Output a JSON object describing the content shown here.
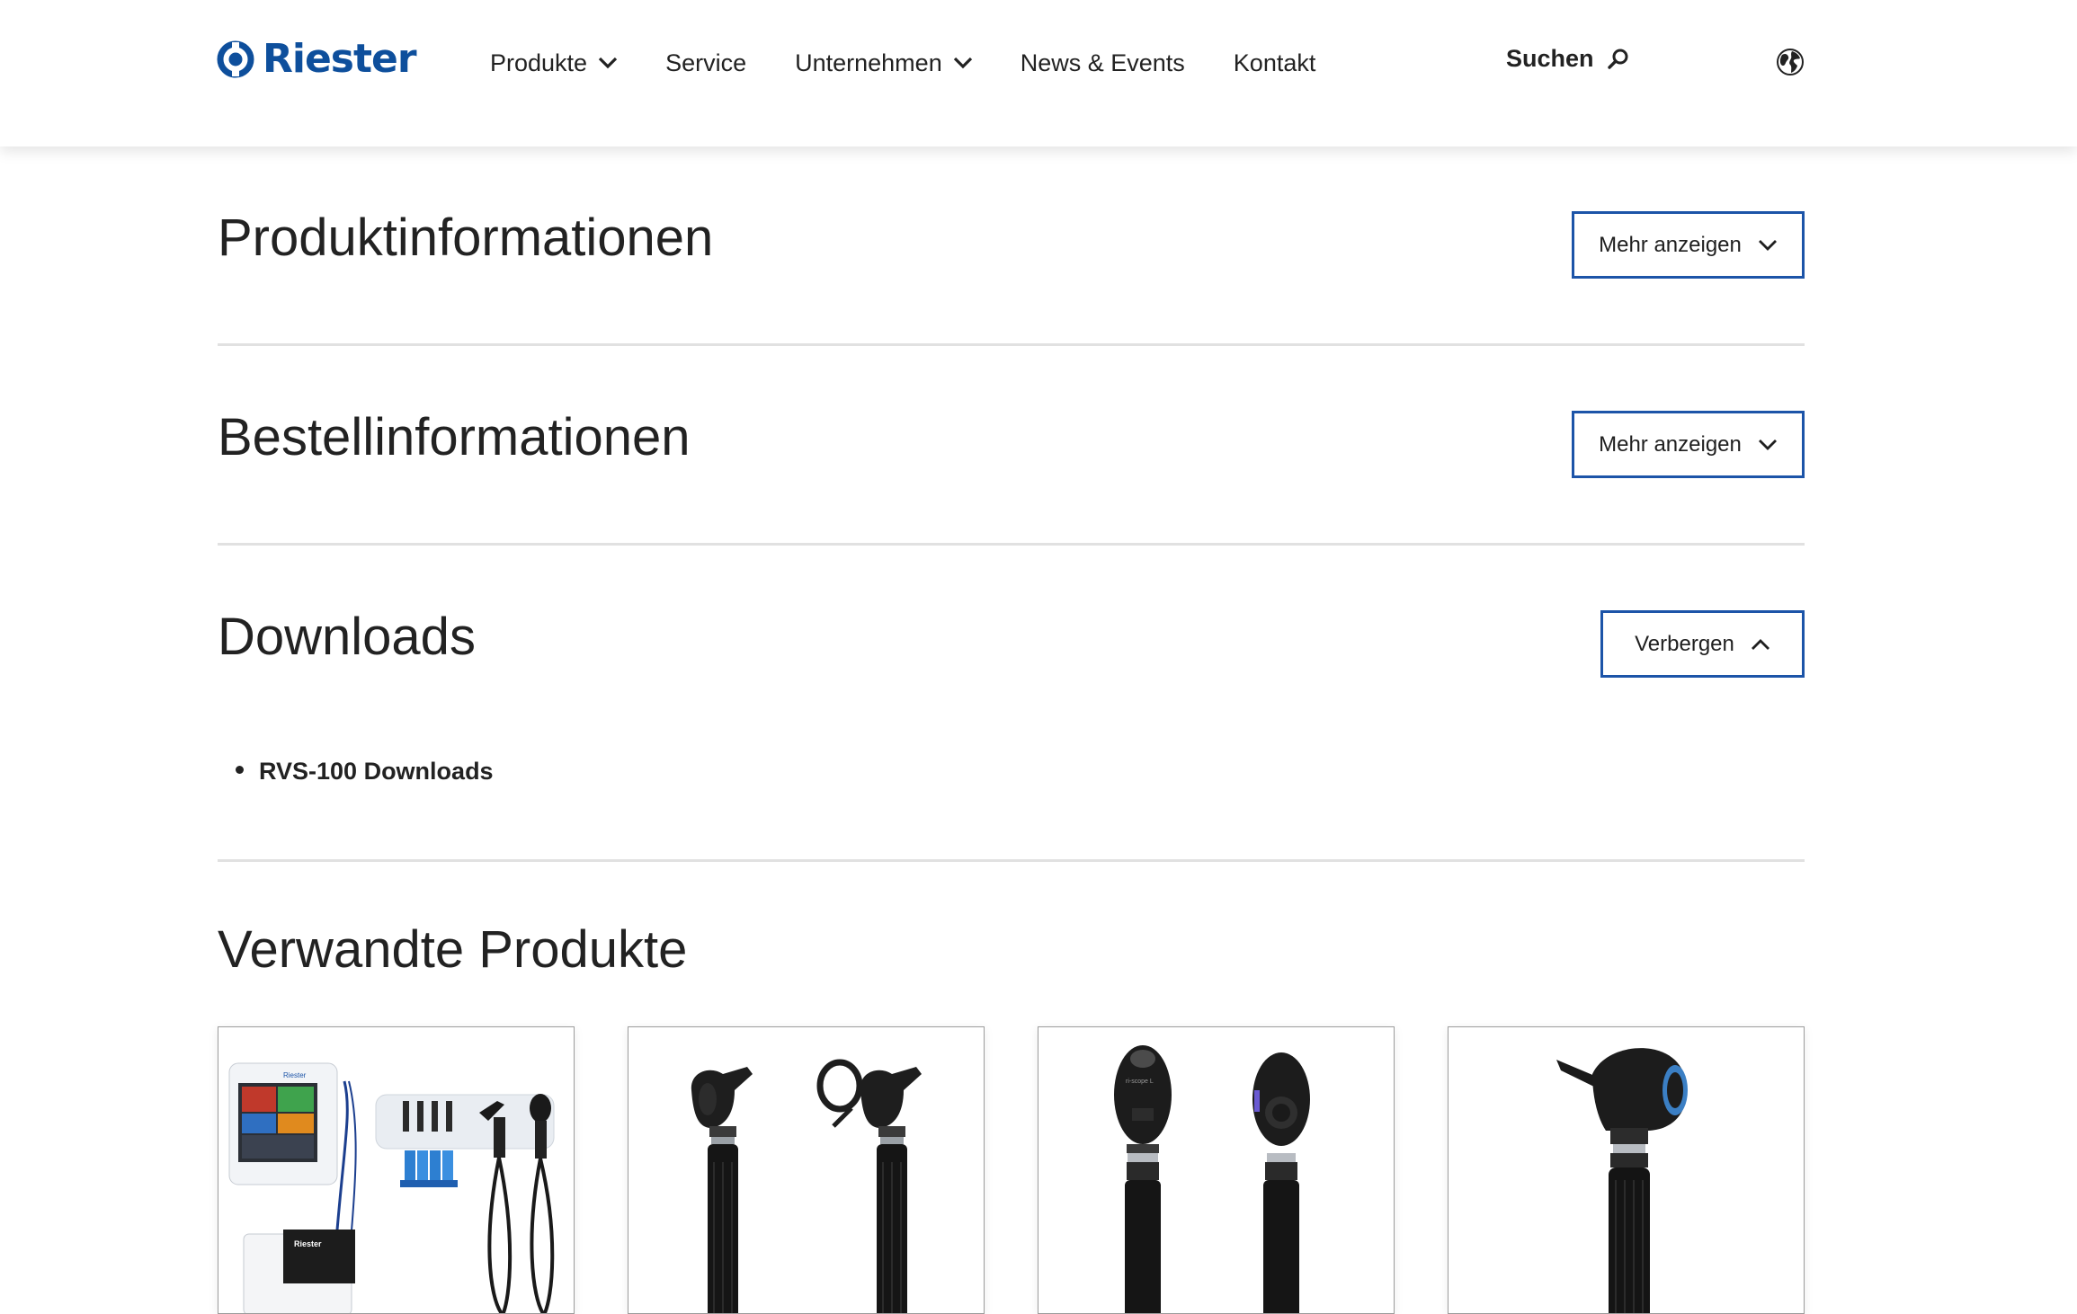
{
  "header": {
    "logo_text": "Riester",
    "nav": [
      {
        "label": "Produkte",
        "has_dropdown": true
      },
      {
        "label": "Service",
        "has_dropdown": false
      },
      {
        "label": "Unternehmen",
        "has_dropdown": true
      },
      {
        "label": "News & Events",
        "has_dropdown": false
      },
      {
        "label": "Kontakt",
        "has_dropdown": false
      }
    ],
    "search_label": "Suchen",
    "language_icon": "globe-icon"
  },
  "sections": {
    "produktinfo": {
      "title": "Produktinformationen",
      "button_label": "Mehr anzeigen",
      "button_icon": "chevron-down-icon"
    },
    "bestellinfo": {
      "title": "Bestellinformationen",
      "button_label": "Mehr anzeigen",
      "button_icon": "chevron-down-icon"
    },
    "downloads": {
      "title": "Downloads",
      "button_label": "Verbergen",
      "button_icon": "chevron-up-icon",
      "items": [
        "RVS-100 Downloads"
      ]
    }
  },
  "related": {
    "title": "Verwandte Produkte",
    "cards": [
      {
        "image": "vital-signs-wall-system-image",
        "device_label": "Riester"
      },
      {
        "image": "otoscope-pair-image"
      },
      {
        "image": "ophthalmoscope-pair-image",
        "device_label": "ri-scope L"
      },
      {
        "image": "single-otoscope-image"
      }
    ]
  },
  "colors": {
    "brand_blue": "#0e4f9c",
    "button_border": "#1c54a8",
    "divider": "#e1e1e1",
    "text": "#222222"
  }
}
